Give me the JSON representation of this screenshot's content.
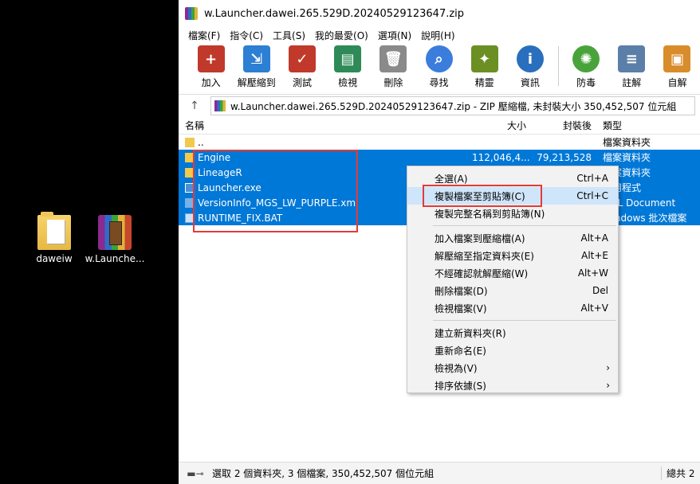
{
  "desktop": {
    "icons": [
      {
        "label": "daweiw",
        "icon": "folder-icon"
      },
      {
        "label": "w.Launche...",
        "icon": "winrar-archive-icon"
      }
    ]
  },
  "window": {
    "title": "w.Launcher.dawei.265.529D.20240529123647.zip",
    "menu": [
      "檔案(F)",
      "指令(C)",
      "工具(S)",
      "我的最愛(O)",
      "選項(N)",
      "說明(H)"
    ],
    "toolbar": [
      {
        "label": "加入",
        "icon": "add-archive-icon",
        "color": "#c0392b"
      },
      {
        "label": "解壓縮到",
        "icon": "extract-to-icon",
        "color": "#2d7fd3"
      },
      {
        "label": "測試",
        "icon": "test-icon",
        "color": "#c0392b"
      },
      {
        "label": "檢視",
        "icon": "view-book-icon",
        "color": "#2e8b57"
      },
      {
        "label": "刪除",
        "icon": "delete-trash-icon",
        "color": "#8a8a8a"
      },
      {
        "label": "尋找",
        "icon": "find-magnifier-icon",
        "color": "#3b7ddd"
      },
      {
        "label": "精靈",
        "icon": "wizard-wand-icon",
        "color": "#6b8f23"
      },
      {
        "label": "資訊",
        "icon": "info-icon",
        "color": "#2a6fbd"
      },
      {
        "label": "防毒",
        "icon": "virus-scan-icon",
        "color": "#49a33b"
      },
      {
        "label": "註解",
        "icon": "comment-icon",
        "color": "#5b7fa8"
      },
      {
        "label": "自解",
        "icon": "sfx-box-icon",
        "color": "#d98c2b"
      }
    ],
    "address_path": "w.Launcher.dawei.265.529D.20240529123647.zip - ZIP 壓縮檔, 未封裝大小 350,452,507 位元組",
    "columns": {
      "name": "名稱",
      "size": "大小",
      "packed": "封裝後",
      "type": "類型"
    },
    "rows": [
      {
        "name": "..",
        "size": "",
        "packed": "",
        "type": "檔案資料夾",
        "icon": "folder",
        "selected": false
      },
      {
        "name": "Engine",
        "size": "112,046,4...",
        "packed": "79,213,528",
        "type": "檔案資料夾",
        "icon": "folder",
        "selected": true
      },
      {
        "name": "LineageR",
        "size": "",
        "packed": "",
        "type": "檔案資料夾",
        "icon": "folder",
        "selected": true
      },
      {
        "name": "Launcher.exe",
        "size": "",
        "packed": "",
        "type": "應用程式",
        "icon": "exe",
        "selected": true
      },
      {
        "name": "VersionInfo_MGS_LW_PURPLE.xml",
        "size": "",
        "packed": "",
        "type": "XML Document",
        "icon": "xml",
        "selected": true
      },
      {
        "name": "RUNTIME_FIX.BAT",
        "size": "",
        "packed": "",
        "type": "Windows 批次檔案",
        "icon": "bat",
        "selected": true
      }
    ],
    "status": {
      "text": "選取 2 個資料夾, 3 個檔案, 350,452,507 個位元組",
      "right": "總共 2"
    }
  },
  "context_menu": {
    "items": [
      {
        "label": "全選(A)",
        "shortcut": "Ctrl+A"
      },
      {
        "label": "複製檔案至剪貼簿(C)",
        "shortcut": "Ctrl+C",
        "highlighted": true
      },
      {
        "label": "複製完整名稱到剪貼簿(N)",
        "shortcut": ""
      },
      {
        "sep": true
      },
      {
        "label": "加入檔案到壓縮檔(A)",
        "shortcut": "Alt+A"
      },
      {
        "label": "解壓縮至指定資料夾(E)",
        "shortcut": "Alt+E"
      },
      {
        "label": "不經確認就解壓縮(W)",
        "shortcut": "Alt+W"
      },
      {
        "label": "刪除檔案(D)",
        "shortcut": "Del"
      },
      {
        "label": "檢視檔案(V)",
        "shortcut": "Alt+V"
      },
      {
        "sep": true
      },
      {
        "label": "建立新資料夾(R)",
        "shortcut": ""
      },
      {
        "label": "重新命名(E)",
        "shortcut": ""
      },
      {
        "label": "檢視為(V)",
        "shortcut": "",
        "submenu": true
      },
      {
        "label": "排序依據(S)",
        "shortcut": "",
        "submenu": true
      }
    ]
  },
  "colors": {
    "selection": "#0078d7",
    "highlight_box": "#e53935",
    "menu_hover": "#cfe5fa"
  }
}
